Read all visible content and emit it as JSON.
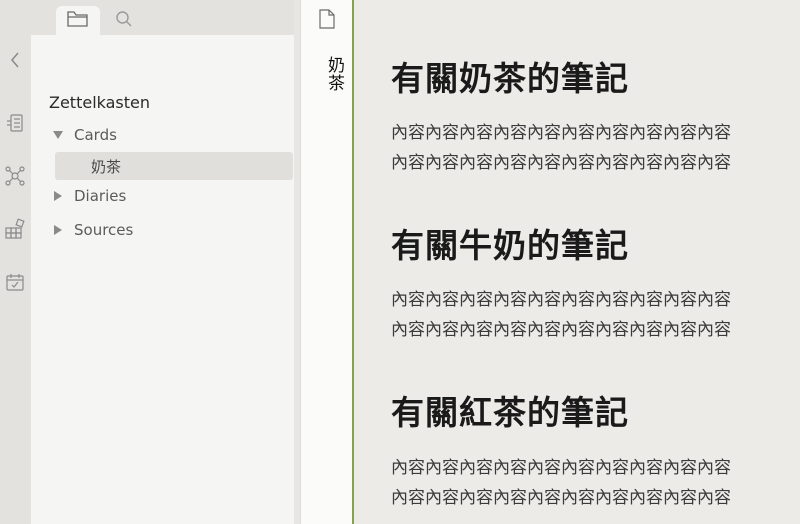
{
  "ribbon": {
    "icons": [
      "collapse-chevron-icon",
      "outline-icon",
      "graph-icon",
      "blocks-icon",
      "calendar-icon"
    ]
  },
  "sidebar": {
    "tabs": [
      "folder-icon",
      "search-icon"
    ],
    "vault_name": "Zettelkasten",
    "tree": [
      {
        "label": "Cards",
        "expanded": true
      },
      {
        "label": "奶茶",
        "selected": true
      },
      {
        "label": "Diaries",
        "expanded": false
      },
      {
        "label": "Sources",
        "expanded": false
      }
    ]
  },
  "title_strip": {
    "title": "奶茶"
  },
  "editor": {
    "sections": [
      {
        "heading": "有關奶茶的筆記",
        "lines": [
          "內容內容內容內容內容內容內容內容內容內容",
          "內容內容內容內容內容內容內容內容內容內容"
        ]
      },
      {
        "heading": "有關牛奶的筆記",
        "lines": [
          "內容內容內容內容內容內容內容內容內容內容",
          "內容內容內容內容內容內容內容內容內容內容"
        ]
      },
      {
        "heading": "有關紅茶的筆記",
        "lines": [
          "內容內容內容內容內容內容內容內容內容內容",
          "內容內容內容內容內容內容內容內容內容內容"
        ]
      }
    ]
  },
  "colors": {
    "accent": "#86a24f",
    "background": "#ecebe8",
    "sidebar": "#f5f5f3"
  }
}
